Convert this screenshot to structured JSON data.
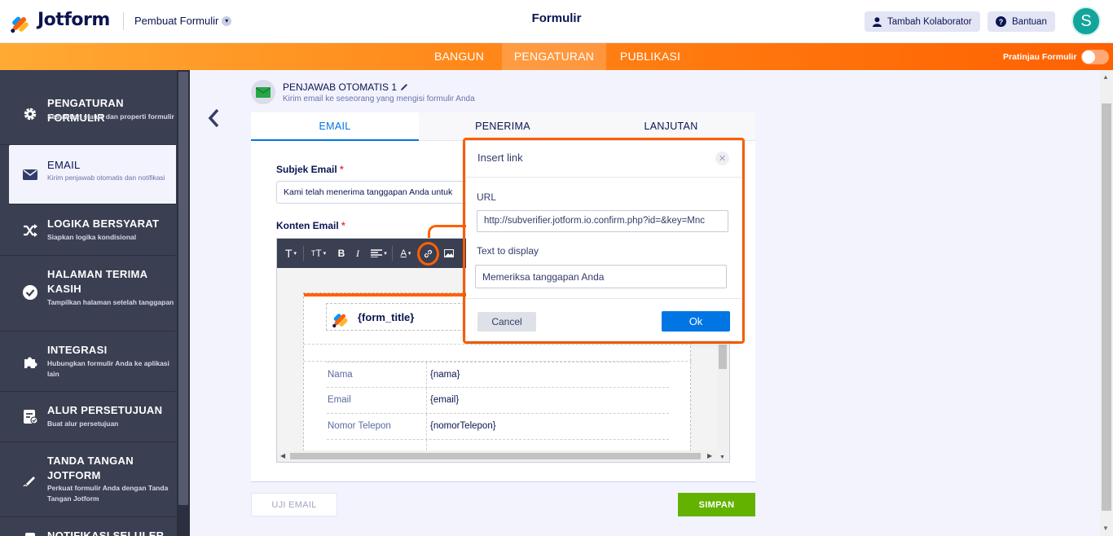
{
  "header": {
    "brand": "Jotform",
    "form_maker": "Pembuat Formulir",
    "form_title": "Formulir",
    "collaborator_btn": "Tambah Kolaborator",
    "help_btn": "Bantuan",
    "avatar_letter": "S"
  },
  "nav": {
    "tabs": [
      "BANGUN",
      "PENGATURAN",
      "PUBLIKASI"
    ],
    "active": "PENGATURAN",
    "preview_label": "Pratinjau Formulir"
  },
  "sidebar": {
    "items": [
      {
        "title": "PENGATURAN FORMULIR",
        "desc": "Sesuaikan status dan properti formulir",
        "icon": "gear-icon"
      },
      {
        "title": "EMAIL",
        "desc": "Kirim penjawab otomatis dan notifikasi",
        "icon": "envelope-icon"
      },
      {
        "title": "LOGIKA BERSYARAT",
        "desc": "Siapkan logika kondisional",
        "icon": "shuffle-icon"
      },
      {
        "title": "HALAMAN TERIMA KASIH",
        "desc": "Tampilkan halaman setelah tanggapan",
        "icon": "check-circle-icon"
      },
      {
        "title": "INTEGRASI",
        "desc": "Hubungkan formulir Anda ke aplikasi lain",
        "icon": "puzzle-icon"
      },
      {
        "title": "ALUR PERSETUJUAN",
        "desc": "Buat alur persetujuan",
        "icon": "approval-icon"
      },
      {
        "title": "TANDA TANGAN JOTFORM",
        "desc": "Perkuat formulir Anda dengan Tanda Tangan Jotform",
        "icon": "pen-icon"
      },
      {
        "title": "NOTIFIKASI SELULER",
        "desc": "",
        "icon": "phone-icon"
      }
    ]
  },
  "autoresponder": {
    "title": "PENJAWAB OTOMATIS 1",
    "subtitle": "Kirim email ke seseorang yang mengisi formulir Anda"
  },
  "tabs": [
    "EMAIL",
    "PENERIMA",
    "LANJUTAN"
  ],
  "form": {
    "subject_label": "Subjek Email",
    "subject_value": "Kami telah menerima tanggapan Anda untuk",
    "content_label": "Konten Email",
    "required_mark": "*"
  },
  "email_template": {
    "title_var": "{form_title}",
    "rows": [
      {
        "key": "Nama",
        "value": "{nama}"
      },
      {
        "key": "Email",
        "value": "{email}"
      },
      {
        "key": "Nomor Telepon",
        "value": "{nomorTelepon}"
      },
      {
        "key": "",
        "value": ""
      }
    ]
  },
  "dialog": {
    "title": "Insert link",
    "url_label": "URL",
    "url_value": "http://subverifier.jotform.io.confirm.php?id=&key=Mnc",
    "text_label": "Text to display",
    "text_value": "Memeriksa tanggapan Anda",
    "cancel": "Cancel",
    "ok": "Ok"
  },
  "footer": {
    "test_btn": "UJI EMAIL",
    "save_btn": "SIMPAN"
  }
}
